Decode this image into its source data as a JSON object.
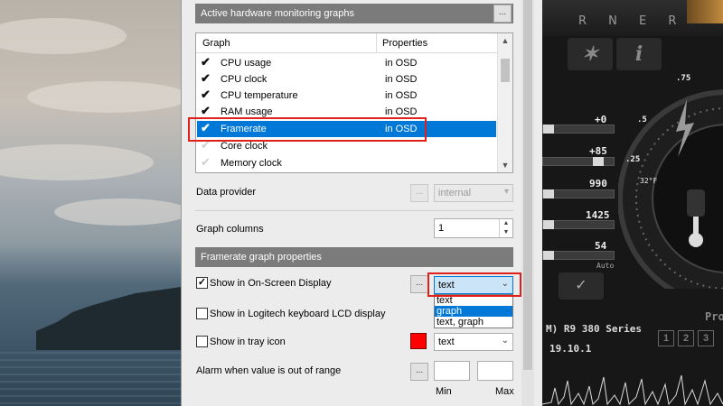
{
  "sections": {
    "active_graphs": "Active hardware monitoring graphs",
    "framerate_props": "Framerate graph properties"
  },
  "buttons": {
    "more": "..."
  },
  "graph_list": {
    "headers": {
      "graph": "Graph",
      "properties": "Properties"
    },
    "rows": [
      {
        "name": "CPU usage",
        "prop": "in OSD",
        "checked": true
      },
      {
        "name": "CPU clock",
        "prop": "in OSD",
        "checked": true
      },
      {
        "name": "CPU temperature",
        "prop": "in OSD",
        "checked": true
      },
      {
        "name": "RAM usage",
        "prop": "in OSD",
        "checked": true
      },
      {
        "name": "Framerate",
        "prop": "in OSD",
        "checked": true,
        "selected": true
      },
      {
        "name": "Core clock",
        "prop": "",
        "checked": false
      },
      {
        "name": "Memory clock",
        "prop": "",
        "checked": false
      }
    ]
  },
  "data_provider": {
    "label": "Data provider",
    "value": "internal"
  },
  "graph_columns": {
    "label": "Graph columns",
    "value": "1"
  },
  "osd": {
    "label": "Show in On-Screen Display",
    "checked": true,
    "value": "text",
    "options": [
      "text",
      "graph",
      "text, graph"
    ],
    "highlighted": "graph"
  },
  "logitech": {
    "label": "Show in Logitech keyboard LCD display",
    "checked": false
  },
  "tray": {
    "label": "Show in tray icon",
    "checked": false,
    "value": "text",
    "color": "#ff0000"
  },
  "alarm": {
    "label": "Alarm when value is out of range",
    "min_label": "Min",
    "max_label": "Max"
  },
  "skin": {
    "brand": "R N E R",
    "slider_values": [
      "+0",
      "+85",
      "990",
      "1425",
      "54"
    ],
    "auto_label": "Auto",
    "temp_label": "32°F",
    "gauge_ticks": [
      ".75",
      ".5",
      ".25"
    ],
    "gpu_name": "M) R9 380 Series",
    "driver": "19.10.1",
    "profile_label": "Pro",
    "profiles": [
      "1",
      "2",
      "3"
    ],
    "info_glyph": "i"
  }
}
